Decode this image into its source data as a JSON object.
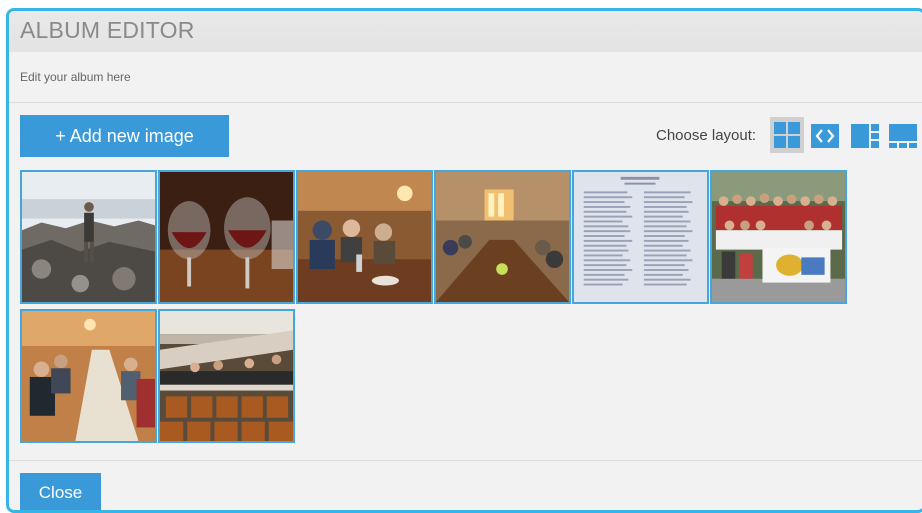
{
  "dialog": {
    "title": "ALBUM EDITOR",
    "subtitle": "Edit your album here"
  },
  "toolbar": {
    "add_label": "+ Add new image",
    "layout_label": "Choose layout:",
    "layouts": [
      {
        "icon": "grid-layout-icon",
        "active": true
      },
      {
        "icon": "carousel-layout-icon",
        "active": false
      },
      {
        "icon": "split-layout-icon",
        "active": false
      },
      {
        "icon": "mosaic-layout-icon",
        "active": false
      }
    ]
  },
  "images": [
    {
      "subject": "person standing on rocky shore"
    },
    {
      "subject": "red wine glasses"
    },
    {
      "subject": "dinner table gathering"
    },
    {
      "subject": "long banquet table"
    },
    {
      "subject": "printed program document"
    },
    {
      "subject": "group photo with banner"
    },
    {
      "subject": "conference room meeting"
    },
    {
      "subject": "lecture hall seats"
    }
  ],
  "footer": {
    "close_label": "Close"
  },
  "colors": {
    "accent": "#3a9ad9",
    "border": "#35b5e8"
  }
}
